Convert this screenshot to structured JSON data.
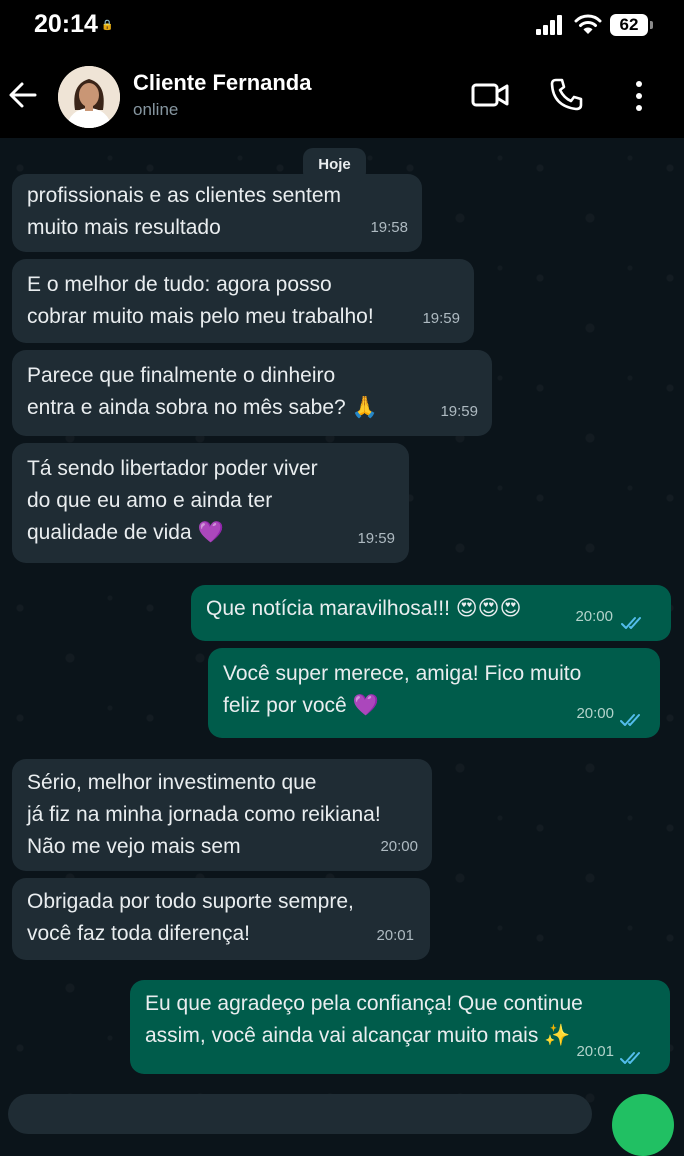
{
  "status": {
    "time": "20:14",
    "battery": "62"
  },
  "header": {
    "name": "Cliente Fernanda",
    "status": "online"
  },
  "date_chip": "Hoje",
  "messages": [
    {
      "dir": "in",
      "text": "profissionais e as clientes sentem\nmuito mais resultado",
      "time": "19:58"
    },
    {
      "dir": "in",
      "text": "E o melhor de tudo: agora posso\ncobrar muito mais pelo meu trabalho!",
      "time": "19:59"
    },
    {
      "dir": "in",
      "text": "Parece que finalmente o dinheiro\nentra e ainda sobra no mês sabe? 🙏",
      "time": "19:59"
    },
    {
      "dir": "in",
      "text": "Tá sendo libertador poder viver\ndo que eu amo e ainda ter\nqualidade de vida 💜",
      "time": "19:59"
    },
    {
      "dir": "out",
      "text": "Que notícia maravilhosa!!! 😍😍😍",
      "time": "20:00",
      "ticks": "read"
    },
    {
      "dir": "out",
      "text": "Você super merece, amiga! Fico muito\nfeliz por você 💜",
      "time": "20:00",
      "ticks": "read"
    },
    {
      "dir": "in",
      "text": "Sério, melhor investimento que\njá fiz na minha jornada como reikiana!\nNão me vejo mais sem",
      "time": "20:00"
    },
    {
      "dir": "in",
      "text": "Obrigada por todo suporte sempre,\nvocê faz toda diferença!",
      "time": "20:01"
    },
    {
      "dir": "out",
      "text": "Eu que agradeço pela confiança! Que continue\nassim, você ainda vai alcançar muito mais ✨",
      "time": "20:01",
      "ticks": "read"
    }
  ],
  "colors": {
    "background": "#0b141a",
    "incoming_bubble": "#1f2c34",
    "outgoing_bubble": "#005c4b",
    "read_ticks": "#53bdeb",
    "accent_green": "#21c063"
  },
  "icons": [
    "back-arrow-icon",
    "video-call-icon",
    "phone-icon",
    "more-options-icon",
    "read-receipt-icon"
  ]
}
